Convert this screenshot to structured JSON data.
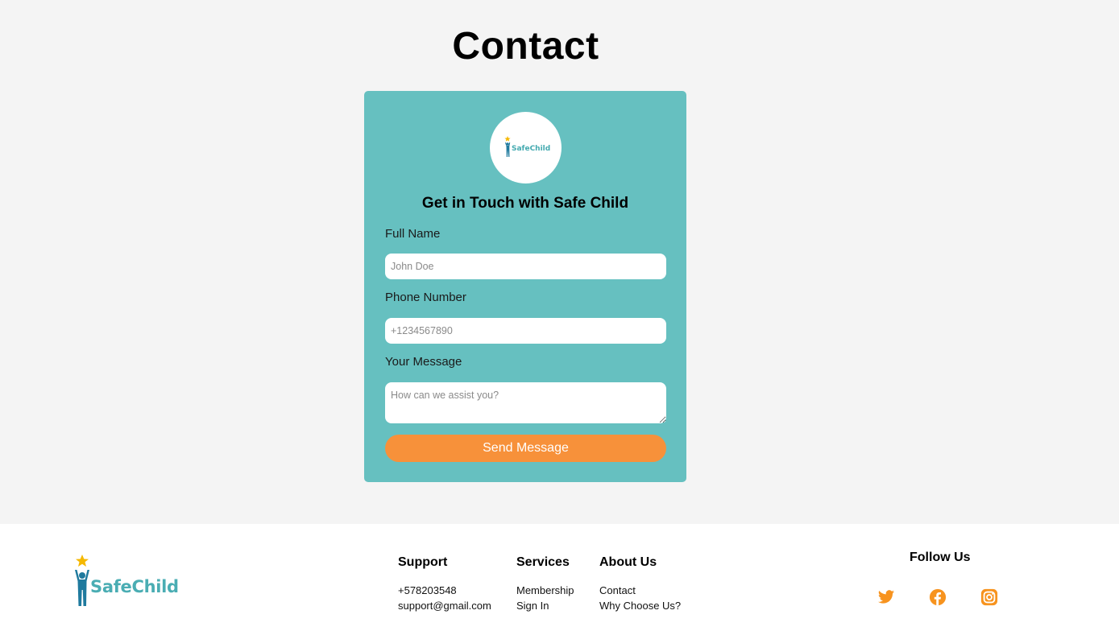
{
  "page": {
    "title": "Contact"
  },
  "card": {
    "logo_text": "SafeChild",
    "heading": "Get in Touch with Safe Child",
    "full_name": {
      "label": "Full Name",
      "placeholder": "John Doe",
      "value": ""
    },
    "phone": {
      "label": "Phone Number",
      "placeholder": "+1234567890",
      "value": ""
    },
    "message": {
      "label": "Your Message",
      "placeholder": "How can we assist you?",
      "value": ""
    },
    "submit_label": "Send Message"
  },
  "footer": {
    "logo_text": "SafeChild",
    "support": {
      "heading": "Support",
      "phone": "+578203548",
      "email": "support@gmail.com"
    },
    "services": {
      "heading": "Services",
      "items": [
        "Membership",
        "Sign In"
      ]
    },
    "about": {
      "heading": "About Us",
      "items": [
        "Contact",
        "Why Choose Us?"
      ]
    },
    "follow": {
      "heading": "Follow Us",
      "icons": [
        "twitter-icon",
        "facebook-icon",
        "instagram-icon"
      ]
    }
  },
  "colors": {
    "background": "#f4f4f4",
    "card": "#66c0c0",
    "accent": "#f7913a",
    "logo_teal": "#4aadb3",
    "star": "#f5b800",
    "logo_figure": "#1f7a9e"
  }
}
